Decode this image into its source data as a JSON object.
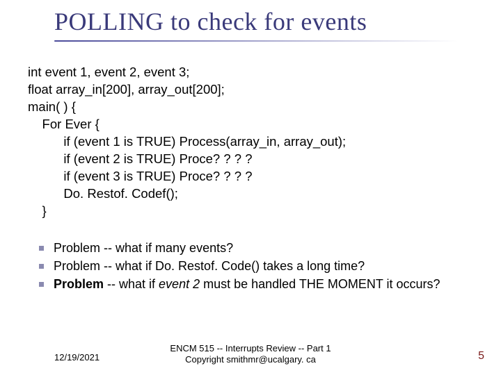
{
  "title": "POLLING to check for events",
  "code": {
    "l1": "int event 1, event 2, event 3;",
    "l2": "float array_in[200], array_out[200];",
    "l3": "main( ) {",
    "l4": "    For Ever {",
    "l5": "          if (event 1 is TRUE) Process(array_in, array_out);",
    "l6": "          if (event 2 is TRUE) Proce? ? ? ?",
    "l7": "          if (event 3 is TRUE) Proce? ? ? ?",
    "l8": "          Do. Restof. Codef();",
    "l9": "    }"
  },
  "bullets": {
    "b1": "Problem -- what if many events?",
    "b2": "Problem -- what if Do. Restof. Code() takes a long time?",
    "b3_pre": "Problem",
    "b3_mid": " -- what if ",
    "b3_ital": "event 2",
    "b3_post": " must be handled THE MOMENT it occurs?"
  },
  "footer": {
    "date": "12/19/2021",
    "center_l1": "ENCM 515 -- Interrupts Review -- Part 1",
    "center_l2": "Copyright smithmr@ucalgary. ca",
    "page": "5"
  }
}
